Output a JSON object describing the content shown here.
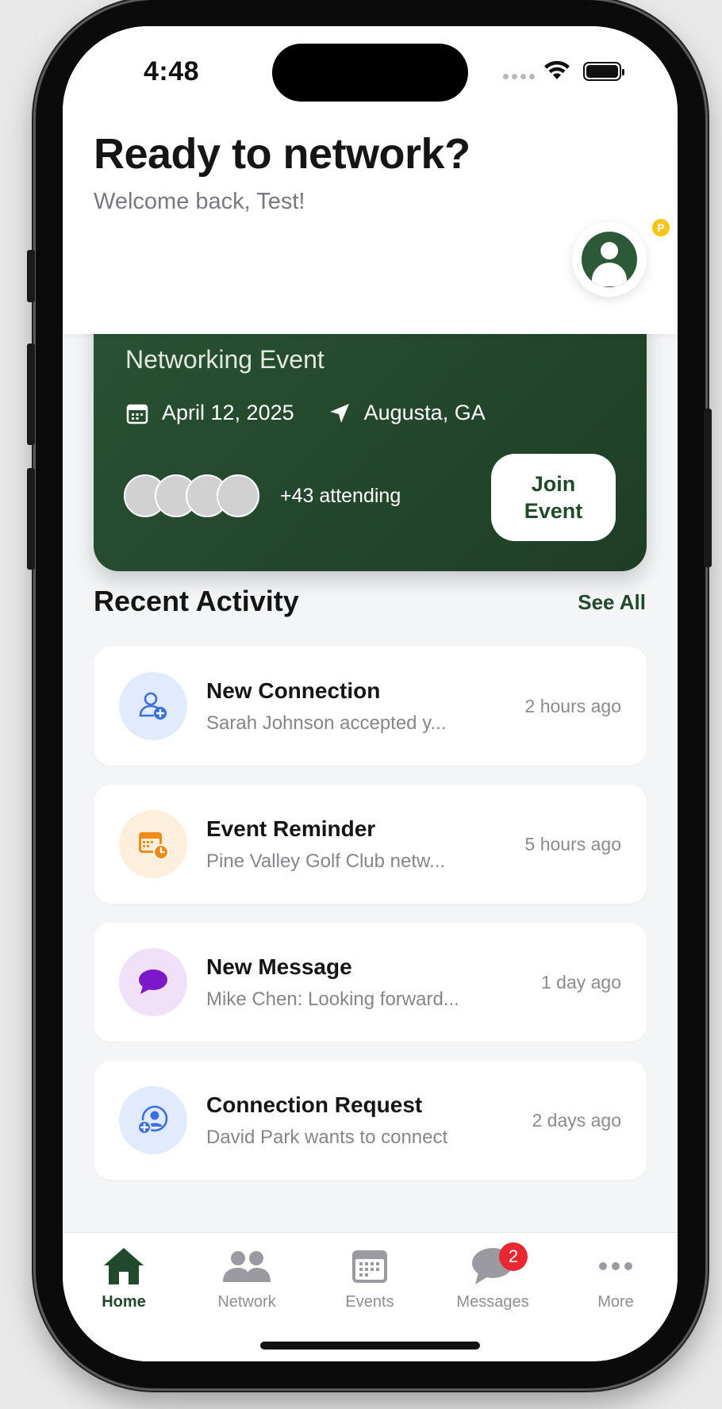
{
  "status_bar": {
    "time": "4:48"
  },
  "header": {
    "title": "Ready to network?",
    "subtitle": "Welcome back, Test!",
    "avatar_badge": "P"
  },
  "event_card": {
    "name": "Networking Event",
    "date": "April 12, 2025",
    "location": "Augusta, GA",
    "attending": "+43 attending",
    "join_label": "Join\nEvent"
  },
  "recent_activity": {
    "title": "Recent Activity",
    "see_all": "See All",
    "items": [
      {
        "title": "New Connection",
        "description": "Sarah Johnson accepted y...",
        "time": "2 hours ago",
        "icon": "person-add-icon"
      },
      {
        "title": "Event Reminder",
        "description": "Pine Valley Golf Club netw...",
        "time": "5 hours ago",
        "icon": "calendar-clock-icon"
      },
      {
        "title": "New Message",
        "description": "Mike Chen: Looking forward...",
        "time": "1 day ago",
        "icon": "chat-bubble-icon"
      },
      {
        "title": "Connection Request",
        "description": "David Park wants to connect",
        "time": "2 days ago",
        "icon": "person-circle-add-icon"
      }
    ]
  },
  "tab_bar": {
    "items": [
      {
        "label": "Home",
        "icon": "home-icon",
        "active": true
      },
      {
        "label": "Network",
        "icon": "people-icon"
      },
      {
        "label": "Events",
        "icon": "calendar-icon"
      },
      {
        "label": "Messages",
        "icon": "messages-icon",
        "badge": "2"
      },
      {
        "label": "More",
        "icon": "more-icon"
      }
    ]
  },
  "colors": {
    "brand_green": "#214a2c",
    "card_green": "#2a5233",
    "badge_red": "#e8282e",
    "badge_yellow": "#f5c518"
  }
}
